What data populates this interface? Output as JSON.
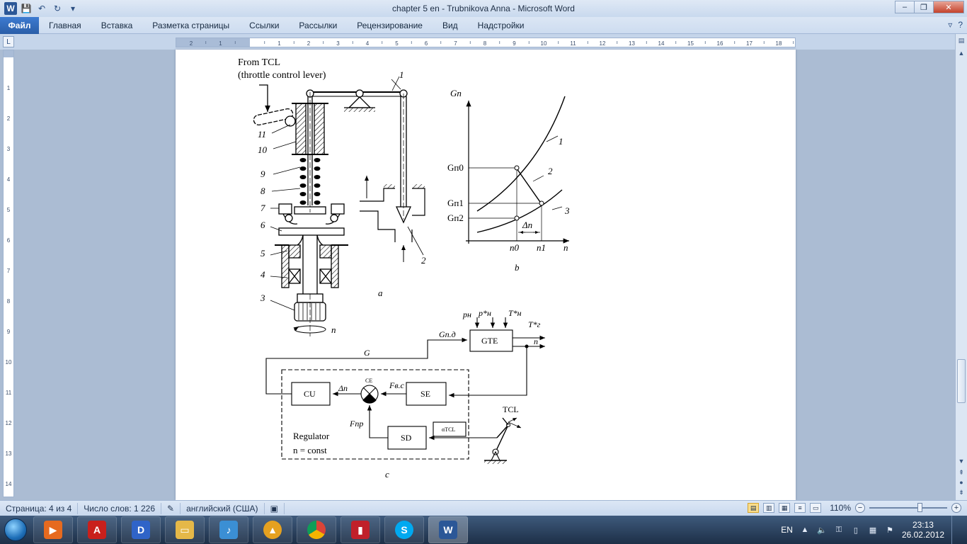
{
  "window": {
    "title": "chapter 5 en - Trubnikova Anna  -  Microsoft Word",
    "minimize_label": "–",
    "restore_label": "❐",
    "close_label": "✕"
  },
  "ribbon": {
    "file_tab": "Файл",
    "tabs": [
      "Главная",
      "Вставка",
      "Разметка страницы",
      "Ссылки",
      "Рассылки",
      "Рецензирование",
      "Вид",
      "Надстройки"
    ]
  },
  "figure": {
    "a": {
      "title_line1": "From TCL",
      "title_line2": "(throttle control lever)",
      "labels": [
        "1",
        "2",
        "3",
        "4",
        "5",
        "6",
        "7",
        "8",
        "9",
        "10",
        "11"
      ],
      "speed_label": "n",
      "caption": "a"
    },
    "b": {
      "y_axis": "Gп",
      "x_axis": "n",
      "g_n0": "Gп0",
      "g_n1": "Gп1",
      "g_n2": "Gп2",
      "n0": "n0",
      "n1": "n1",
      "delta_n": "Δn",
      "curve_labels": [
        "1",
        "2",
        "3"
      ],
      "caption": "b"
    },
    "c": {
      "gte": "GTE",
      "cu": "CU",
      "se": "SE",
      "sd": "SD",
      "ce": "CE",
      "tcl": "TCL",
      "alpha_tcl": "αTCL",
      "g": "G",
      "g_pd": "Gп.д",
      "delta_n": "Δn",
      "f_bc": "Fв.с",
      "f_pr": "Fпр",
      "n_out": "n",
      "p_n": "pн",
      "p_star_n": "p*н",
      "t_star_n": "T*н",
      "t_star_g": "T*г",
      "regulator": "Regulator",
      "regulator_rule": "n = const",
      "caption": "c"
    }
  },
  "status": {
    "page": "Страница: 4 из 4",
    "words": "Число слов: 1 226",
    "language": "английский (США)",
    "zoom": "110%"
  },
  "taskbar": {
    "language": "EN",
    "time": "23:13",
    "date": "26.02.2012"
  }
}
